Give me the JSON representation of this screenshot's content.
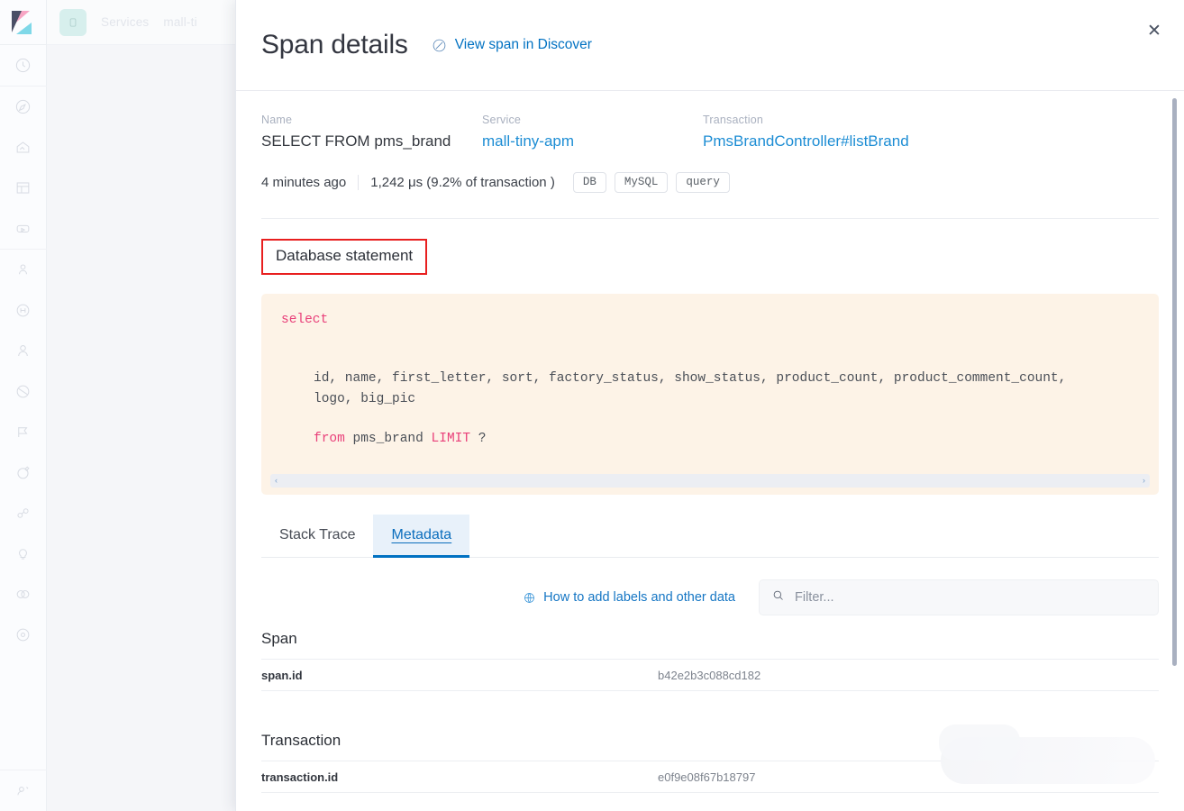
{
  "background": {
    "breadcrumbs": [
      "Services",
      "mall-ti"
    ],
    "sidebar_icons": [
      "clock-icon",
      "compass-icon",
      "home-uptime-icon",
      "dashboard-icon",
      "apm-icon",
      "logs-icon",
      "metrics-icon",
      "user-icon",
      "maps-icon",
      "flag-icon",
      "edit-icon",
      "graph-icon",
      "bulb-icon",
      "heart-icon",
      "gear-circle-icon"
    ],
    "footer_icon": "user-settings-icon"
  },
  "flyout": {
    "title": "Span details",
    "discover_link": "View span in Discover",
    "discover_icon": "discover-icon",
    "close_icon": "close-icon",
    "fields": [
      {
        "label": "Name",
        "value": "SELECT FROM pms_brand",
        "is_link": false
      },
      {
        "label": "Service",
        "value": "mall-tiny-apm",
        "is_link": true
      },
      {
        "label": "Transaction",
        "value": "PmsBrandController#listBrand",
        "is_link": true
      }
    ],
    "timestamp": "4 minutes ago",
    "duration": "1,242 μs (9.2% of transaction )",
    "badges": [
      "DB",
      "MySQL",
      "query"
    ],
    "section_title": "Database statement",
    "sql": {
      "line1_kw": "select",
      "line2": "id, name, first_letter, sort, factory_status, show_status, product_count, product_comment_count,",
      "line3": "logo, big_pic",
      "line4_from": "from",
      "line4_table": "pms_brand",
      "line4_limit": "LIMIT",
      "line4_param": "?",
      "scroll_left": "‹",
      "scroll_right": "›"
    },
    "tabs": [
      {
        "label": "Stack Trace",
        "active": false
      },
      {
        "label": "Metadata",
        "active": true
      }
    ],
    "labels_link": "How to add labels and other data",
    "labels_link_icon": "globe-icon",
    "filter_icon": "search-icon",
    "filter_placeholder": "Filter...",
    "metadata": [
      {
        "section": "Span",
        "rows": [
          {
            "key": "span.id",
            "value": "b42e2b3c088cd182"
          }
        ]
      },
      {
        "section": "Transaction",
        "rows": [
          {
            "key": "transaction.id",
            "value": "e0f9e08f67b18797"
          }
        ]
      }
    ]
  },
  "colors": {
    "accent_blue": "#0071c2",
    "link_blue": "#1d8dd4",
    "annotation_red": "#e81f1f",
    "code_bg": "#fdf3e7",
    "sql_keyword": "#e9407a"
  }
}
